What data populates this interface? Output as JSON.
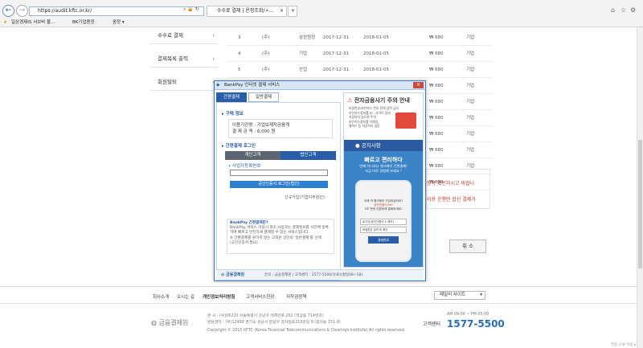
{
  "browser": {
    "url": "https://audit.kftc.or.kr/",
    "tab_title": "수수료 결제 | 온정조회/ㅅ...",
    "favorites": [
      "일상경제IS 서브바 불...",
      "BK기업용정",
      "웅정 ▾"
    ]
  },
  "sidebar": {
    "items": [
      {
        "label": "수수료 결제"
      },
      {
        "label": "결제목록 출력"
      },
      {
        "label": "회원탈퇴"
      }
    ]
  },
  "table": {
    "rows": [
      {
        "no": "3",
        "name": "(주)",
        "type": "삼성원정",
        "date1": "2017-12-31",
        "date2": "2018-01-05",
        "amount": "₩ 680",
        "kind": "기업"
      },
      {
        "no": "4",
        "name": "(주)",
        "type": "기업",
        "date1": "2017-12-31",
        "date2": "2018-01-05",
        "amount": "₩ 680",
        "kind": "기업"
      },
      {
        "no": "5",
        "name": "(주)",
        "type": "산업",
        "date1": "2017-12-31",
        "date2": "2018-01-05",
        "amount": "₩ 680",
        "kind": "기업"
      },
      {
        "no": "",
        "name": "",
        "type": "",
        "date1": "",
        "date2": "",
        "amount": "₩ 680",
        "kind": "기업"
      },
      {
        "no": "",
        "name": "",
        "type": "",
        "date1": "",
        "date2": "",
        "amount": "₩ 680",
        "kind": "기업"
      },
      {
        "no": "",
        "name": "",
        "type": "",
        "date1": "",
        "date2": "",
        "amount": "₩ 680",
        "kind": "기업"
      },
      {
        "no": "",
        "name": "",
        "type": "",
        "date1": "",
        "date2": "",
        "amount": "₩ 680",
        "kind": "기업"
      },
      {
        "no": "",
        "name": "",
        "type": "",
        "date1": "",
        "date2": "",
        "amount": "₩ 680",
        "kind": "기업"
      },
      {
        "no": "",
        "name": "",
        "type": "",
        "date1": "",
        "date2": "",
        "amount": "₩ 680",
        "kind": "기업"
      },
      {
        "no": "",
        "name": "",
        "type": "",
        "date1": "",
        "date2": "",
        "amount": "₩ 680",
        "kind": ""
      }
    ]
  },
  "notice_side": {
    "line1": "항목 확인하시고 바랍니",
    "line2": "이용 운행만 합산 결제가"
  },
  "cancel_label": "취 소",
  "popup": {
    "title": "BankPay 인터넷 결제 서비스",
    "tabs": [
      "간편결제",
      "일반결제"
    ],
    "purchase_title": "구매 정보",
    "usage_label": "이용기관명 : 기업보제저금융계",
    "amount_label": "결 제 금 액 : 6,000 원",
    "login_title": "간편결제 로그인",
    "login_tabs": [
      "개인고객",
      "법인고객"
    ],
    "biz_number_label": "사업자등록번호",
    "cert_button": "공인인증서 로그인(법인)",
    "signup_link": "신규가입(기업이무원인)",
    "info_title": "BankPay 간편결제란?",
    "info_text": "BankPay 서비스 이용시 최초 사용하는 결제정보를 사전에 등록하여 빠르고 안전하게 결제할 수 있는 서비스입니다.",
    "info_text2": "※ 간편결제를 원하지 않는 고객은 상단의 '일반결제'를 선택",
    "info_text3": "(공인인증서 필요)",
    "footer_logo": "금융결제원",
    "footer_text": "문의 : 금융결제원 | 고객센터 : 1577-5500(유료)(평일09~18)",
    "warn_title": "전자금융사기 주의 안내",
    "warn_lines": [
      "비밀번호/보안카드 번호 전체 입력 금지",
      "보안카드정보를 PC, 사이트 등에",
      "저장하지 않도록 주의",
      "보안카드정보를 이메일,",
      "웹하드 등 저장하지 않음"
    ],
    "notice_title": "공지사항",
    "promo_title": "빠르고 편리하다",
    "promo_sub": "언제 어디서나 뱅크페이 간편결제!",
    "promo_sub2": "지금 바로 경험해 보세요 !",
    "phone_q": "이제 막 뱅크페이 가입하셨어요?",
    "phone_q2": "공인인증서 NO",
    "phone_q3": "2초 만에 간편하게 결제하세요!",
    "phone_step1": "로그인(공인인증서 ✔ 체크)",
    "phone_step2": "비밀번호 입력 후 확인",
    "phone_btn": "결제완료"
  },
  "footer": {
    "links": [
      "회사소개",
      "오시는 길",
      "개인정보처리방침",
      "고객서비스헌장",
      "저작권정책"
    ],
    "family_site": "패밀리 사이트",
    "logo": "금융결제원",
    "address1": "본 사 : (우)06220 서울특별시 강남구 테헤란로 202 (역삼동 714번지)",
    "address2": "분당센터 : (우)13490 경기도 성남시 분당구 정자일로213번길 9 (정자동 151-9)",
    "copyright": "Copyright © 2015 KFTC (Korea Financial Telecommunications & Clearings Institute) All rights reserved.",
    "cs_label": "고객센터",
    "cs_hours": "AM 09:00 ~ PM 05:00",
    "cs_phone": "1577-5500",
    "status_tip": "연동 오류 이용 ▸"
  }
}
